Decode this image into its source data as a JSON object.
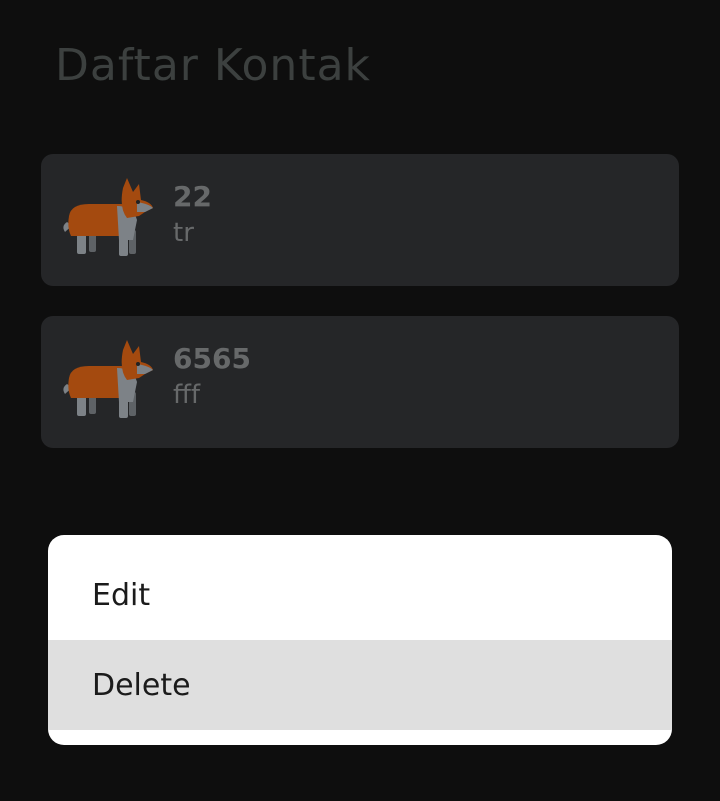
{
  "header": {
    "title": "Daftar Kontak"
  },
  "contacts": [
    {
      "name": "22",
      "phone": "tr",
      "avatar_icon": "corgi-icon"
    },
    {
      "name": "6565",
      "phone": "fff",
      "avatar_icon": "corgi-icon"
    }
  ],
  "context_menu": {
    "items": [
      {
        "label": "Edit"
      },
      {
        "label": "Delete"
      }
    ]
  },
  "colors": {
    "background": "#0e0e0e",
    "card": "#252628",
    "menu_background": "#ffffff",
    "menu_highlight": "#dfdfdf",
    "corgi_orange": "#a44a0f",
    "corgi_gray": "#7d8287"
  }
}
